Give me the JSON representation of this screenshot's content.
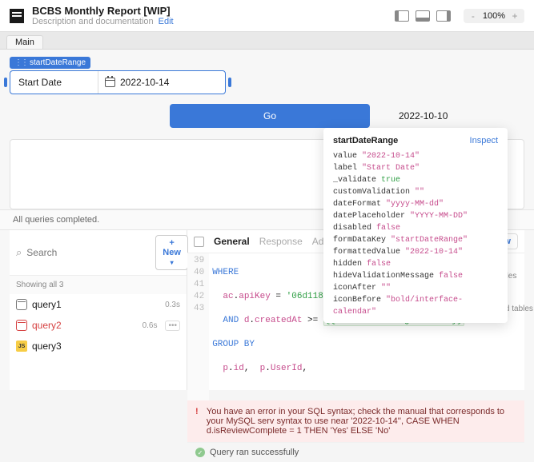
{
  "header": {
    "title": "BCBS Monthly Report [WIP]",
    "subtitle": "Description and documentation",
    "edit": "Edit",
    "zoom": {
      "minus": "-",
      "value": "100%",
      "plus": "+"
    }
  },
  "tabs": {
    "main": "Main"
  },
  "widget": {
    "chip": "startDateRange",
    "label": "Start Date",
    "value": "2022-10-14"
  },
  "go": {
    "button": "Go",
    "date": "2022-10-10"
  },
  "status": "All queries completed.",
  "left": {
    "search_placeholder": "Search",
    "new": "+ New",
    "showing": "Showing all 3",
    "queries": [
      {
        "name": "query1",
        "time": "0.3s",
        "type": "db"
      },
      {
        "name": "query2",
        "time": "0.6s",
        "type": "db",
        "error": true,
        "more": "•••"
      },
      {
        "name": "query3",
        "time": "",
        "type": "js"
      }
    ]
  },
  "codeTabs": {
    "general": "General",
    "response": "Response",
    "advanced": "Advanc",
    "preview": "Preview"
  },
  "editor": {
    "lines": [
      {
        "n": 39,
        "kw": "WHERE",
        "rest": ""
      },
      {
        "n": 40,
        "indent": "  ",
        "col1": "ac",
        "dot1": ".",
        "col2": "apiKey",
        "eq": " = ",
        "str": "'06d11811c"
      },
      {
        "n": 41,
        "indent": "  ",
        "kw": "AND ",
        "col1": "d",
        "dot1": ".",
        "col2": "createdAt",
        "cmp": " >= ",
        "expr": "{{ startDateRange.value }}"
      },
      {
        "n": 42,
        "kw": "GROUP BY",
        "rest": ""
      },
      {
        "n": 43,
        "indent": "  ",
        "col1": "p",
        "dot1": ".",
        "col2": "id",
        "comma": ",  ",
        "col3": "p",
        "dot2": ".",
        "col4": "UserId",
        "tail": ","
      }
    ]
  },
  "error": "You have an error in your SQL syntax; check the manual that corresponds to your MySQL serv syntax to use near '2022-10-14'', CASE WHEN d.isReviewComplete = 1 THEN 'Yes' ELSE 'No'",
  "ok": "Query ran successfully",
  "side": {
    "search": "rch tables",
    "related": "Related tables"
  },
  "popover": {
    "title": "startDateRange",
    "inspect": "Inspect",
    "props": [
      {
        "k": "value",
        "v": "\"2022-10-14\"",
        "t": "str"
      },
      {
        "k": "label",
        "v": "\"Start Date\"",
        "t": "str"
      },
      {
        "k": "_validate",
        "v": "true",
        "t": "bool-t"
      },
      {
        "k": "customValidation",
        "v": "\"\"",
        "t": "str"
      },
      {
        "k": "dateFormat",
        "v": "\"yyyy-MM-dd\"",
        "t": "str"
      },
      {
        "k": "datePlaceholder",
        "v": "\"YYYY-MM-DD\"",
        "t": "str"
      },
      {
        "k": "disabled",
        "v": "false",
        "t": "bool-f"
      },
      {
        "k": "formDataKey",
        "v": "\"startDateRange\"",
        "t": "str"
      },
      {
        "k": "formattedValue",
        "v": "\"2022-10-14\"",
        "t": "str"
      },
      {
        "k": "hidden",
        "v": "false",
        "t": "bool-f"
      },
      {
        "k": "hideValidationMessage",
        "v": "false",
        "t": "bool-f"
      },
      {
        "k": "iconAfter",
        "v": "\"\"",
        "t": "str"
      },
      {
        "k": "iconBefore",
        "v": "\"bold/interface-calendar\"",
        "t": "str"
      }
    ]
  }
}
